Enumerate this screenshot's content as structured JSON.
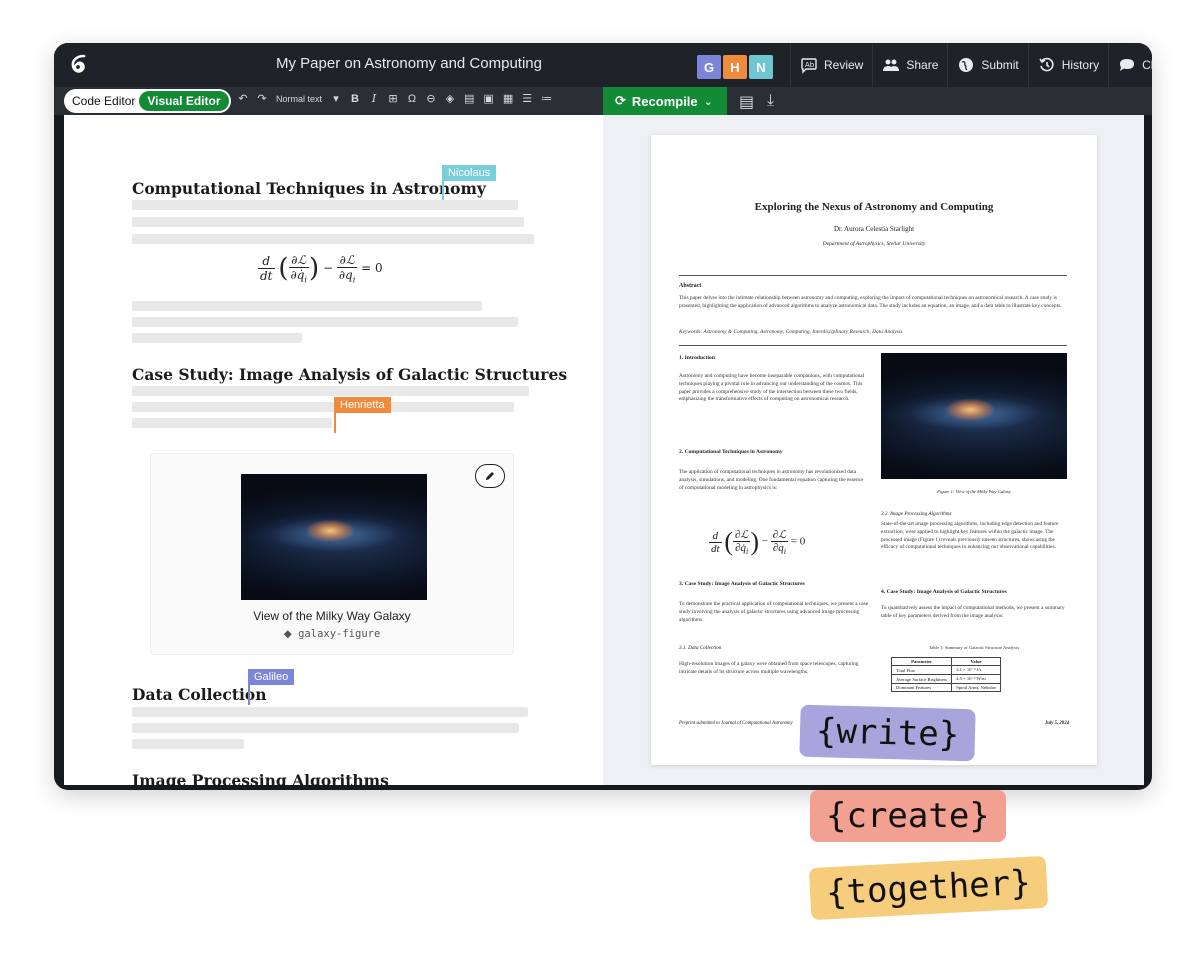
{
  "app": {
    "title": "My Paper on Astronomy and Computing",
    "collaborators": [
      {
        "initial": "G",
        "color": "#7b86d9"
      },
      {
        "initial": "H",
        "color": "#f08a3c"
      },
      {
        "initial": "N",
        "color": "#6ec6d0"
      }
    ],
    "actions": {
      "review": "Review",
      "share": "Share",
      "submit": "Submit",
      "history": "History",
      "chat": "Chat"
    }
  },
  "toolbar": {
    "code_editor": "Code Editor",
    "visual_editor": "Visual Editor",
    "text_style": "Normal text",
    "recompile": "Recompile"
  },
  "editor": {
    "heading1": "Computational Techniques in Astronomy",
    "heading2": "Case Study: Image Analysis of Galactic Structures",
    "heading3": "Data Collection",
    "heading4": "Image Processing Algorithms",
    "cursors": {
      "nicolaus": {
        "name": "Nicolaus",
        "color": "#78cfd9"
      },
      "henrietta": {
        "name": "Henrietta",
        "color": "#f08a3c"
      },
      "galileo": {
        "name": "Galileo",
        "color": "#7b86d9"
      }
    },
    "figure": {
      "caption": "View of the Milky Way Galaxy",
      "label": "galaxy-figure"
    }
  },
  "preview": {
    "title": "Exploring the Nexus of Astronomy and Computing",
    "author": "Dr. Aurora Celestia Starlight",
    "affiliation": "Department of Astrophysics, Stellar University",
    "abstract_heading": "Abstract",
    "abstract_text": "This paper delves into the intimate relationship between astronomy and computing, exploring the impact of computational techniques on astronomical research. A case study is presented, highlighting the application of advanced algorithms to analyze astronomical data. The study includes an equation, an image, and a data table to illustrate key concepts.",
    "keywords": "Keywords: Astronomy & Computing, Astronomy, Computing, Interdisciplinary Research, Data Analysis",
    "sec1_heading": "1. Introduction",
    "sec1_text": "Astronomy and computing have become inseparable companions, with computational techniques playing a pivotal role in advancing our understanding of the cosmos. This paper provides a comprehensive study of the intersection between these two fields, emphasizing the transformative effects of computing on astronomical research.",
    "sec2_heading": "2. Computational Techniques in Astronomy",
    "sec2_text": "The application of computational techniques in astronomy has revolutionized data analysis, simulations, and modeling. One fundamental equation capturing the essence of computational modeling in astrophysics is:",
    "sec3_heading": "3. Case Study: Image Analysis of Galactic Structures",
    "sec3_text": "To demonstrate the practical application of computational techniques, we present a case study involving the analysis of galactic structures using advanced image processing algorithms.",
    "sub31_heading": "3.1. Data Collection",
    "sub31_text": "High-resolution images of a galaxy were obtained from space telescopes, capturing intricate details of its structure across multiple wavelengths.",
    "fig_caption": "Figure 1: View of the Milky Way Galaxy",
    "sub32_heading": "3.2. Image Processing Algorithms",
    "sub32_text": "State-of-the-art image processing algorithms, including edge detection and feature extraction, were applied to highlight key features within the galactic image. The processed image (Figure 1) reveals previously unseen structures, showcasing the efficacy of computational techniques in enhancing our observational capabilities.",
    "sec4_heading": "4. Case Study: Image Analysis of Galactic Structures",
    "sec4_text": "To quantitatively assess the impact of computational methods, we present a summary table of key parameters derived from the image analysis:",
    "table_caption": "Table 1: Summary of Galactic Structure Analysis",
    "table_headers": [
      "Parameter",
      "Value"
    ],
    "table_rows": [
      [
        "Total Flux",
        "2.1 × 10⁻⁹ J/s"
      ],
      [
        "Average Surface Brightness",
        "4.5 × 10⁻⁶ W/m"
      ],
      [
        "Dominant Features",
        "Spiral Arms, Nebulae"
      ]
    ],
    "footer_left": "Preprint submitted to Journal of Computational Astronomy",
    "footer_right": "July 5, 2024"
  },
  "stickers": {
    "write": {
      "text": "{write}",
      "color": "#a7a5dc"
    },
    "create": {
      "text": "{create}",
      "color": "#f1a091"
    },
    "together": {
      "text": "{together}",
      "color": "#f6cd7d"
    }
  }
}
